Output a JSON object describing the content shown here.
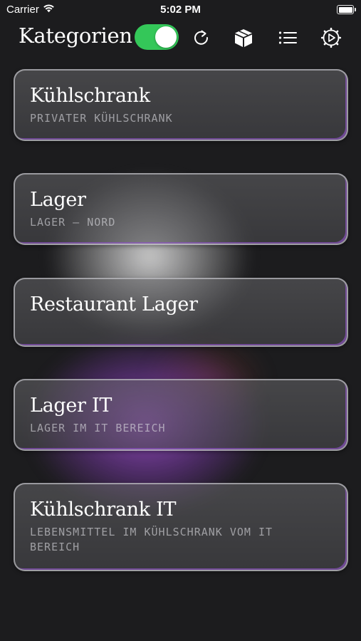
{
  "status_bar": {
    "carrier": "Carrier",
    "time": "5:02 PM"
  },
  "header": {
    "title": "Kategorien",
    "toggle_on": true,
    "toggle_color": "#34c759",
    "icons": [
      "refresh-icon",
      "box-icon",
      "list-icon",
      "settings-play-icon"
    ]
  },
  "categories": [
    {
      "title": "Kühlschrank",
      "subtitle": "PRIVATER KÜHLSCHRANK"
    },
    {
      "title": "Lager",
      "subtitle": "LAGER – NORD"
    },
    {
      "title": "Restaurant Lager",
      "subtitle": ""
    },
    {
      "title": "Lager IT",
      "subtitle": "LAGER IM IT BEREICH"
    },
    {
      "title": "Kühlschrank IT",
      "subtitle": "LEBENSMITTEL IM KÜHLSCHRANK VOM IT BEREICH"
    }
  ],
  "colors": {
    "background": "#1c1c1e",
    "accent_purple": "#9b55c8"
  }
}
